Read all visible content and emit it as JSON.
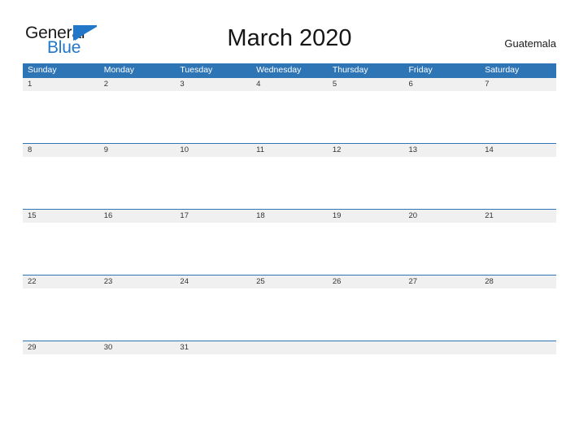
{
  "brand": {
    "name_part1": "General",
    "name_part2": "Blue",
    "mark": "triangle-flag",
    "color_primary": "#2277c8",
    "color_text": "#1a1a1a"
  },
  "header": {
    "title": "March 2020",
    "country": "Guatemala"
  },
  "calendar": {
    "header_color": "#2e75b6",
    "date_band_color": "#f0f0f0",
    "month": "March",
    "year": "2020",
    "weekdays": [
      "Sunday",
      "Monday",
      "Tuesday",
      "Wednesday",
      "Thursday",
      "Friday",
      "Saturday"
    ],
    "weeks": [
      {
        "days": [
          "1",
          "2",
          "3",
          "4",
          "5",
          "6",
          "7"
        ]
      },
      {
        "days": [
          "8",
          "9",
          "10",
          "11",
          "12",
          "13",
          "14"
        ]
      },
      {
        "days": [
          "15",
          "16",
          "17",
          "18",
          "19",
          "20",
          "21"
        ]
      },
      {
        "days": [
          "22",
          "23",
          "24",
          "25",
          "26",
          "27",
          "28"
        ]
      },
      {
        "days": [
          "29",
          "30",
          "31",
          "",
          "",
          "",
          ""
        ]
      }
    ]
  }
}
